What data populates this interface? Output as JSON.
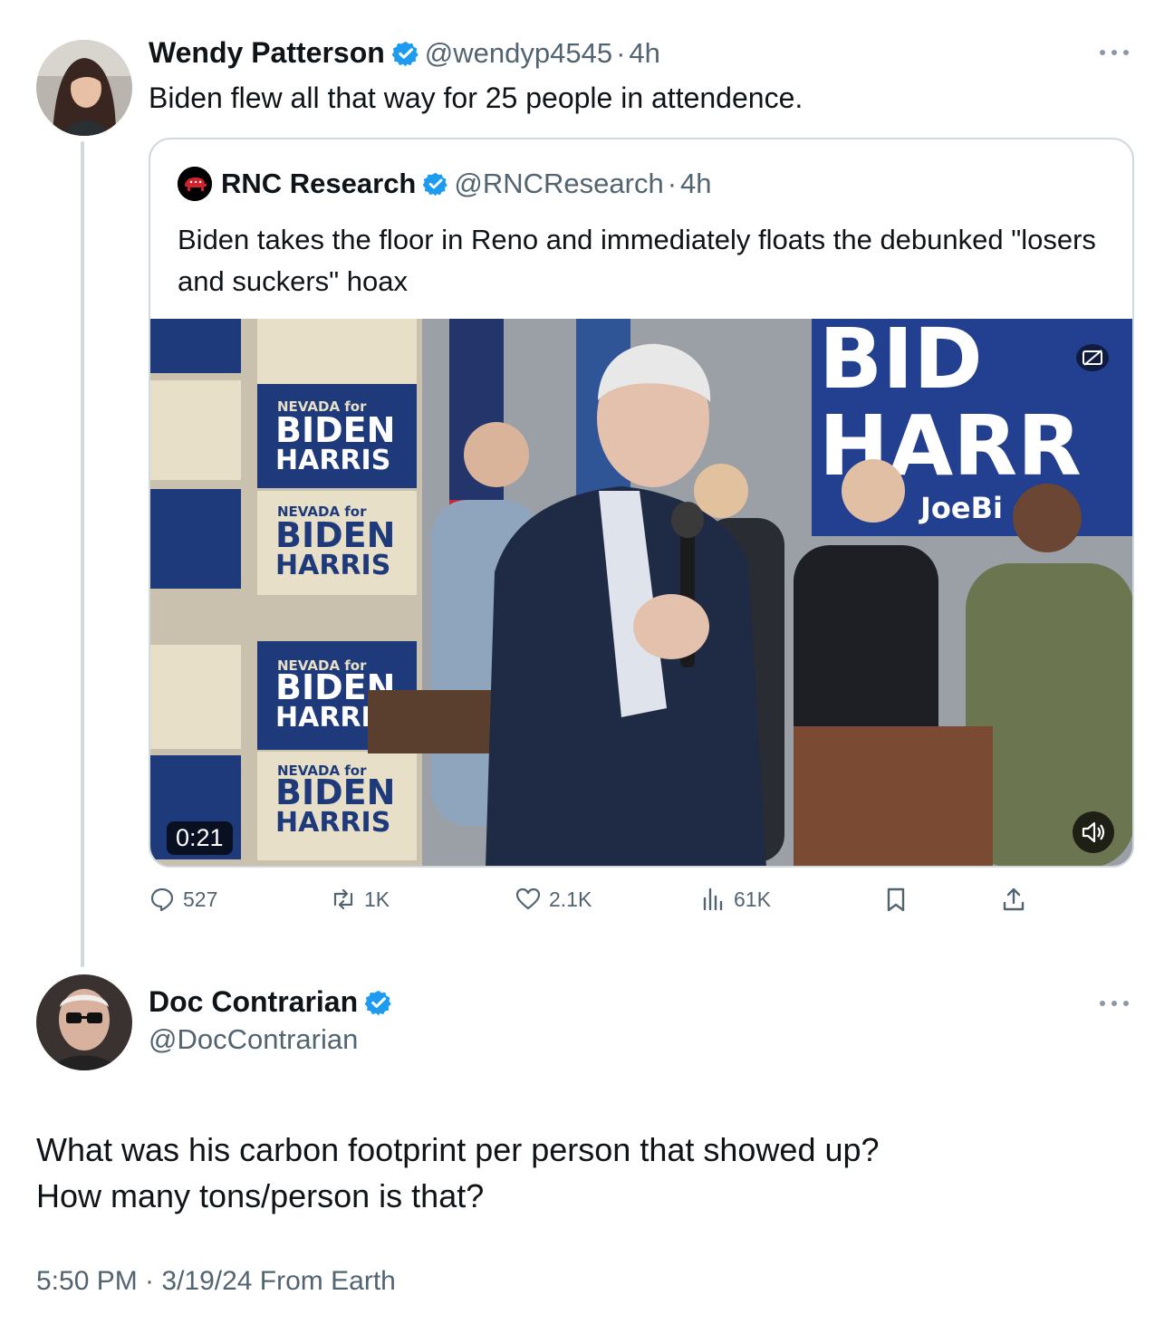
{
  "tweet": {
    "author_name": "Wendy Patterson",
    "handle": "@wendyp4545",
    "separator": "·",
    "time": "4h",
    "text": "Biden flew all that way for 25 people in attendence."
  },
  "quoted": {
    "author_name": "RNC Research",
    "handle": "@RNCResearch",
    "separator": "·",
    "time": "4h",
    "text": "Biden takes the floor in Reno and immediately floats the debunked \"losers and suckers\" hoax",
    "video_duration": "0:21",
    "signs": {
      "line_nevada": "NEVADA for",
      "line_biden": "BIDEN",
      "line_harris": "HARRIS",
      "screen_top": "BID",
      "screen_mid": "HARR",
      "screen_url": "JoeBi    co"
    }
  },
  "metrics": {
    "replies": "527",
    "reposts": "1K",
    "likes": "2.1K",
    "views": "61K"
  },
  "reply": {
    "author_name": "Doc Contrarian",
    "handle": "@DocContrarian",
    "text_line1": "What was his carbon footprint per person that showed up?",
    "text_line2": "How many tons/person is that?",
    "meta": "5:50 PM · 3/19/24 From Earth"
  },
  "icons": [
    "verified-badge-icon",
    "more-icon",
    "reply-icon",
    "repost-icon",
    "like-icon",
    "views-icon",
    "bookmark-icon",
    "share-icon",
    "mute-icon",
    "captions-icon"
  ],
  "colors": {
    "verified": "#1d9bf0",
    "secondary_text": "#536471",
    "border": "#cfd9de"
  }
}
